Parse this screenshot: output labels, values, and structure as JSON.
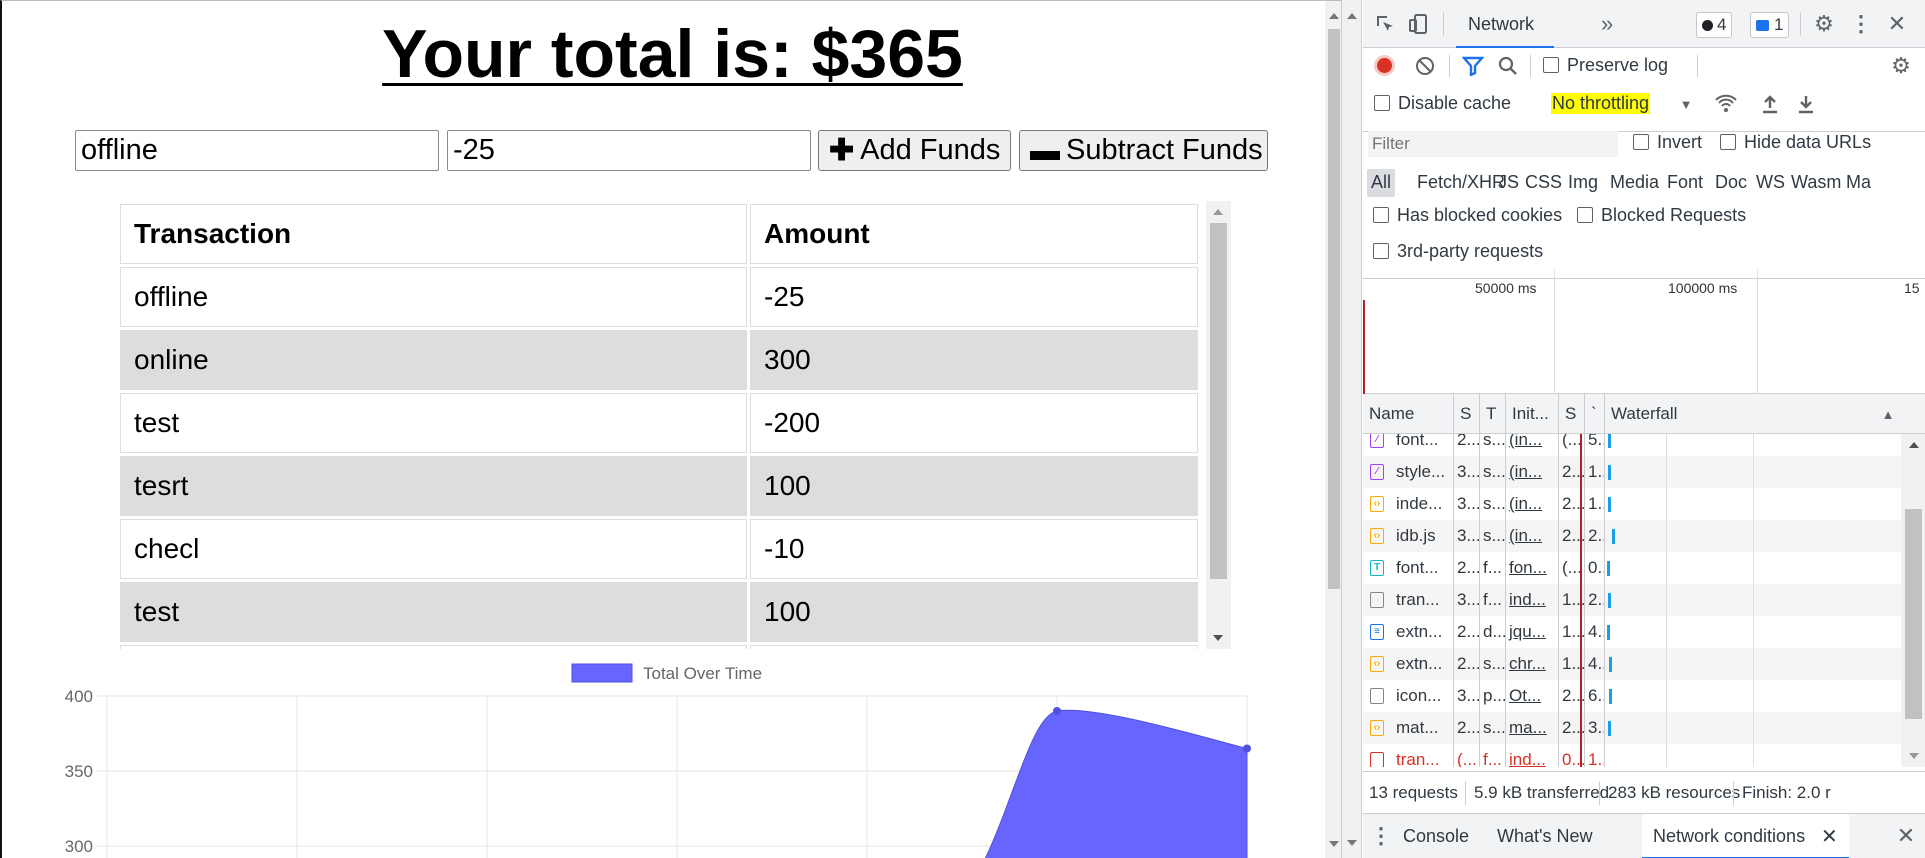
{
  "app": {
    "total_title": "Your total is: $365",
    "name_input_value": "offline",
    "amount_input_value": "-25",
    "add_button": {
      "icon": "plus-icon",
      "label": "Add Funds"
    },
    "subtract_button": {
      "icon": "minus-icon",
      "label": "Subtract Funds"
    },
    "table": {
      "headers": [
        "Transaction",
        "Amount"
      ],
      "rows": [
        [
          "offline",
          "-25"
        ],
        [
          "online",
          "300"
        ],
        [
          "test",
          "-200"
        ],
        [
          "tesrt",
          "100"
        ],
        [
          "checl",
          "-10"
        ],
        [
          "test",
          "100"
        ]
      ]
    }
  },
  "chart_data": {
    "type": "area",
    "series": [
      {
        "name": "Total Over Time",
        "color": "#6666ff",
        "points": [
          [
            5,
            390
          ],
          [
            6,
            365
          ]
        ]
      }
    ],
    "x_categories": 7,
    "y_ticks": [
      400,
      350,
      300
    ],
    "legend_position": "top",
    "grid": true
  },
  "devtools": {
    "toolbar": {
      "icons": [
        "inspect-element-icon",
        "device-toolbar-icon"
      ],
      "active_tab": "Network",
      "more_tabs": "»",
      "errors_count": "4",
      "messages_count": "1"
    },
    "controls": {
      "preserve_log": "Preserve log",
      "disable_cache": "Disable cache",
      "throttling": "No throttling",
      "throttling_highlight": "#ffff00"
    },
    "filter": {
      "placeholder": "Filter",
      "invert": "Invert",
      "hide_data_urls": "Hide data URLs",
      "types": [
        "All",
        "Fetch/XHR",
        "JS",
        "CSS",
        "Img",
        "Media",
        "Font",
        "Doc",
        "WS",
        "Wasm",
        "Ma"
      ],
      "has_blocked_cookies": "Has blocked cookies",
      "blocked_requests": "Blocked Requests",
      "third_party": "3rd-party requests"
    },
    "overview": {
      "ticks": [
        "50000 ms",
        "100000 ms",
        "15"
      ]
    },
    "columns": {
      "name": "Name",
      "status": "S",
      "type": "T",
      "initiator": "Init...",
      "size": "S",
      "time": "`",
      "waterfall": "Waterfall"
    },
    "requests": [
      {
        "icon": "font-file-icon",
        "color": "#a142f4",
        "glyph": "⁄",
        "name": "font...",
        "status": "2...",
        "type": "s...",
        "initiator": "(in...",
        "size": "(...",
        "time": "5...",
        "bar": 20
      },
      {
        "icon": "stylesheet-file-icon",
        "color": "#a142f4",
        "glyph": "⁄",
        "name": "style...",
        "status": "3...",
        "type": "s...",
        "initiator": "(in...",
        "size": "2...",
        "time": "1...",
        "bar": 20
      },
      {
        "icon": "script-file-icon",
        "color": "#f9ab00",
        "glyph": "‹›",
        "name": "inde...",
        "status": "3...",
        "type": "s...",
        "initiator": "(in...",
        "size": "2...",
        "time": "1...",
        "bar": 20
      },
      {
        "icon": "script-file-icon",
        "color": "#f9ab00",
        "glyph": "‹›",
        "name": "idb.js",
        "status": "3...",
        "type": "s...",
        "initiator": "(in...",
        "size": "2...",
        "time": "2...",
        "bar": 24
      },
      {
        "icon": "font-text-icon",
        "color": "#12b5cb",
        "glyph": "T",
        "name": "font...",
        "status": "2...",
        "type": "f...",
        "initiator": "fon...",
        "size": "(...",
        "time": "0...",
        "bar": 19
      },
      {
        "icon": "generic-file-icon",
        "color": "#80868b",
        "glyph": "",
        "name": "tran...",
        "status": "3...",
        "type": "f...",
        "initiator": "ind...",
        "size": "1...",
        "time": "2...",
        "bar": 20
      },
      {
        "icon": "document-file-icon",
        "color": "#1a73e8",
        "glyph": "≡",
        "name": "extn...",
        "status": "2...",
        "type": "d...",
        "initiator": "jqu...",
        "size": "1...",
        "time": "4...",
        "bar": 19
      },
      {
        "icon": "script-file-icon",
        "color": "#f9ab00",
        "glyph": "‹›",
        "name": "extn...",
        "status": "2...",
        "type": "s...",
        "initiator": "chr...",
        "size": "1...",
        "time": "4...",
        "bar": 21
      },
      {
        "icon": "generic-file-icon",
        "color": "#80868b",
        "glyph": "",
        "name": "icon...",
        "status": "3...",
        "type": "p...",
        "initiator": "Ot...",
        "size": "2...",
        "time": "6...",
        "bar": 21
      },
      {
        "icon": "script-file-icon",
        "color": "#f9ab00",
        "glyph": "‹›",
        "name": "mat...",
        "status": "2...",
        "type": "s...",
        "initiator": "ma...",
        "size": "2...",
        "time": "3...",
        "bar": 20
      },
      {
        "icon": "failed-file-icon",
        "color": "#d93025",
        "glyph": "",
        "name": "tran...",
        "status": "(...",
        "type": "f...",
        "initiator": "ind...",
        "size": "0...",
        "time": "1...",
        "bar": null,
        "error": true
      }
    ],
    "status": {
      "requests": "13 requests",
      "transferred": "5.9 kB transferred",
      "resources": "283 kB resources",
      "finish": "Finish: 2.0 r"
    },
    "drawer": {
      "tabs": [
        "Console",
        "What's New",
        "Network conditions"
      ],
      "active": "Network conditions"
    }
  }
}
